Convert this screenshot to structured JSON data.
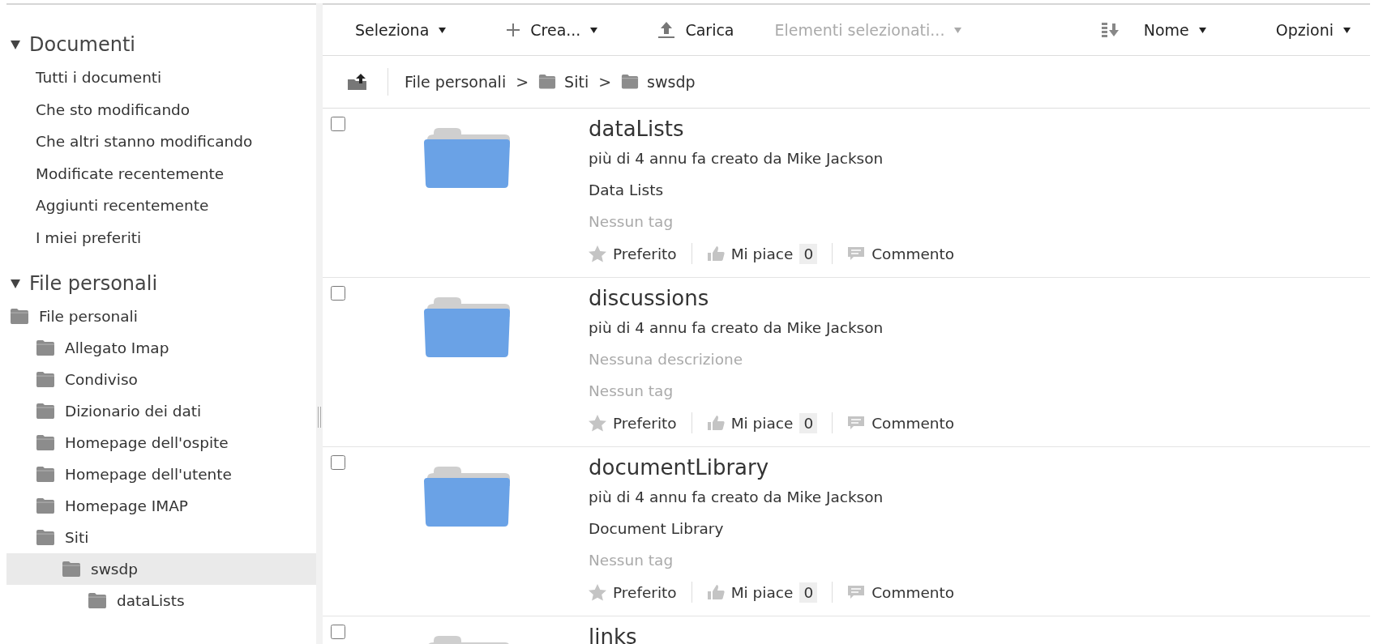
{
  "sidebar": {
    "sections": [
      {
        "title": "Documenti",
        "expanded": true,
        "items": [
          "Tutti i documenti",
          "Che sto modificando",
          "Che altri stanno modificando",
          "Modificate recentemente",
          "Aggiunti recentemente",
          "I miei preferiti"
        ]
      },
      {
        "title": "File personali",
        "expanded": true,
        "tree": [
          {
            "label": "File personali",
            "selected": false,
            "children": [
              {
                "label": "Allegato Imap",
                "selected": false
              },
              {
                "label": "Condiviso",
                "selected": false
              },
              {
                "label": "Dizionario dei dati",
                "selected": false
              },
              {
                "label": "Homepage dell'ospite",
                "selected": false
              },
              {
                "label": "Homepage dell'utente",
                "selected": false
              },
              {
                "label": "Homepage IMAP",
                "selected": false
              },
              {
                "label": "Siti",
                "selected": false,
                "children": [
                  {
                    "label": "swsdp",
                    "selected": true,
                    "children": [
                      {
                        "label": "dataLists",
                        "selected": false
                      }
                    ]
                  }
                ]
              }
            ]
          }
        ]
      }
    ]
  },
  "toolbar": {
    "actions": [
      {
        "label": "Seleziona",
        "kind": "menu",
        "disabled": false
      },
      {
        "label": "Crea...",
        "kind": "create",
        "disabled": false
      },
      {
        "label": "Carica",
        "kind": "upload",
        "disabled": false
      },
      {
        "label": "Elementi selezionati...",
        "kind": "menu",
        "disabled": true
      }
    ],
    "sort": {
      "label": "Nome"
    },
    "options": {
      "label": "Opzioni"
    }
  },
  "breadcrumb": [
    {
      "label": "File personali"
    },
    {
      "separator": ">",
      "label": "Siti"
    },
    {
      "separator": ">",
      "label": "swsdp"
    }
  ],
  "items": [
    {
      "checked": false,
      "title": "dataLists",
      "meta": "più di 4 annu fa creato da Mike Jackson",
      "description": "Data Lists",
      "description_empty": false,
      "tags": "Nessun tag",
      "favorite": "Preferito",
      "like": "Mi piace",
      "like_count": "0",
      "comment": "Commento"
    },
    {
      "checked": false,
      "title": "discussions",
      "meta": "più di 4 annu fa creato da Mike Jackson",
      "description": "Nessuna descrizione",
      "description_empty": true,
      "tags": "Nessun tag",
      "favorite": "Preferito",
      "like": "Mi piace",
      "like_count": "0",
      "comment": "Commento"
    },
    {
      "checked": false,
      "title": "documentLibrary",
      "meta": "più di 4 annu fa creato da Mike Jackson",
      "description": "Document Library",
      "description_empty": false,
      "tags": "Nessun tag",
      "favorite": "Preferito",
      "like": "Mi piace",
      "like_count": "0",
      "comment": "Commento"
    },
    {
      "checked": false,
      "title": "links"
    }
  ]
}
